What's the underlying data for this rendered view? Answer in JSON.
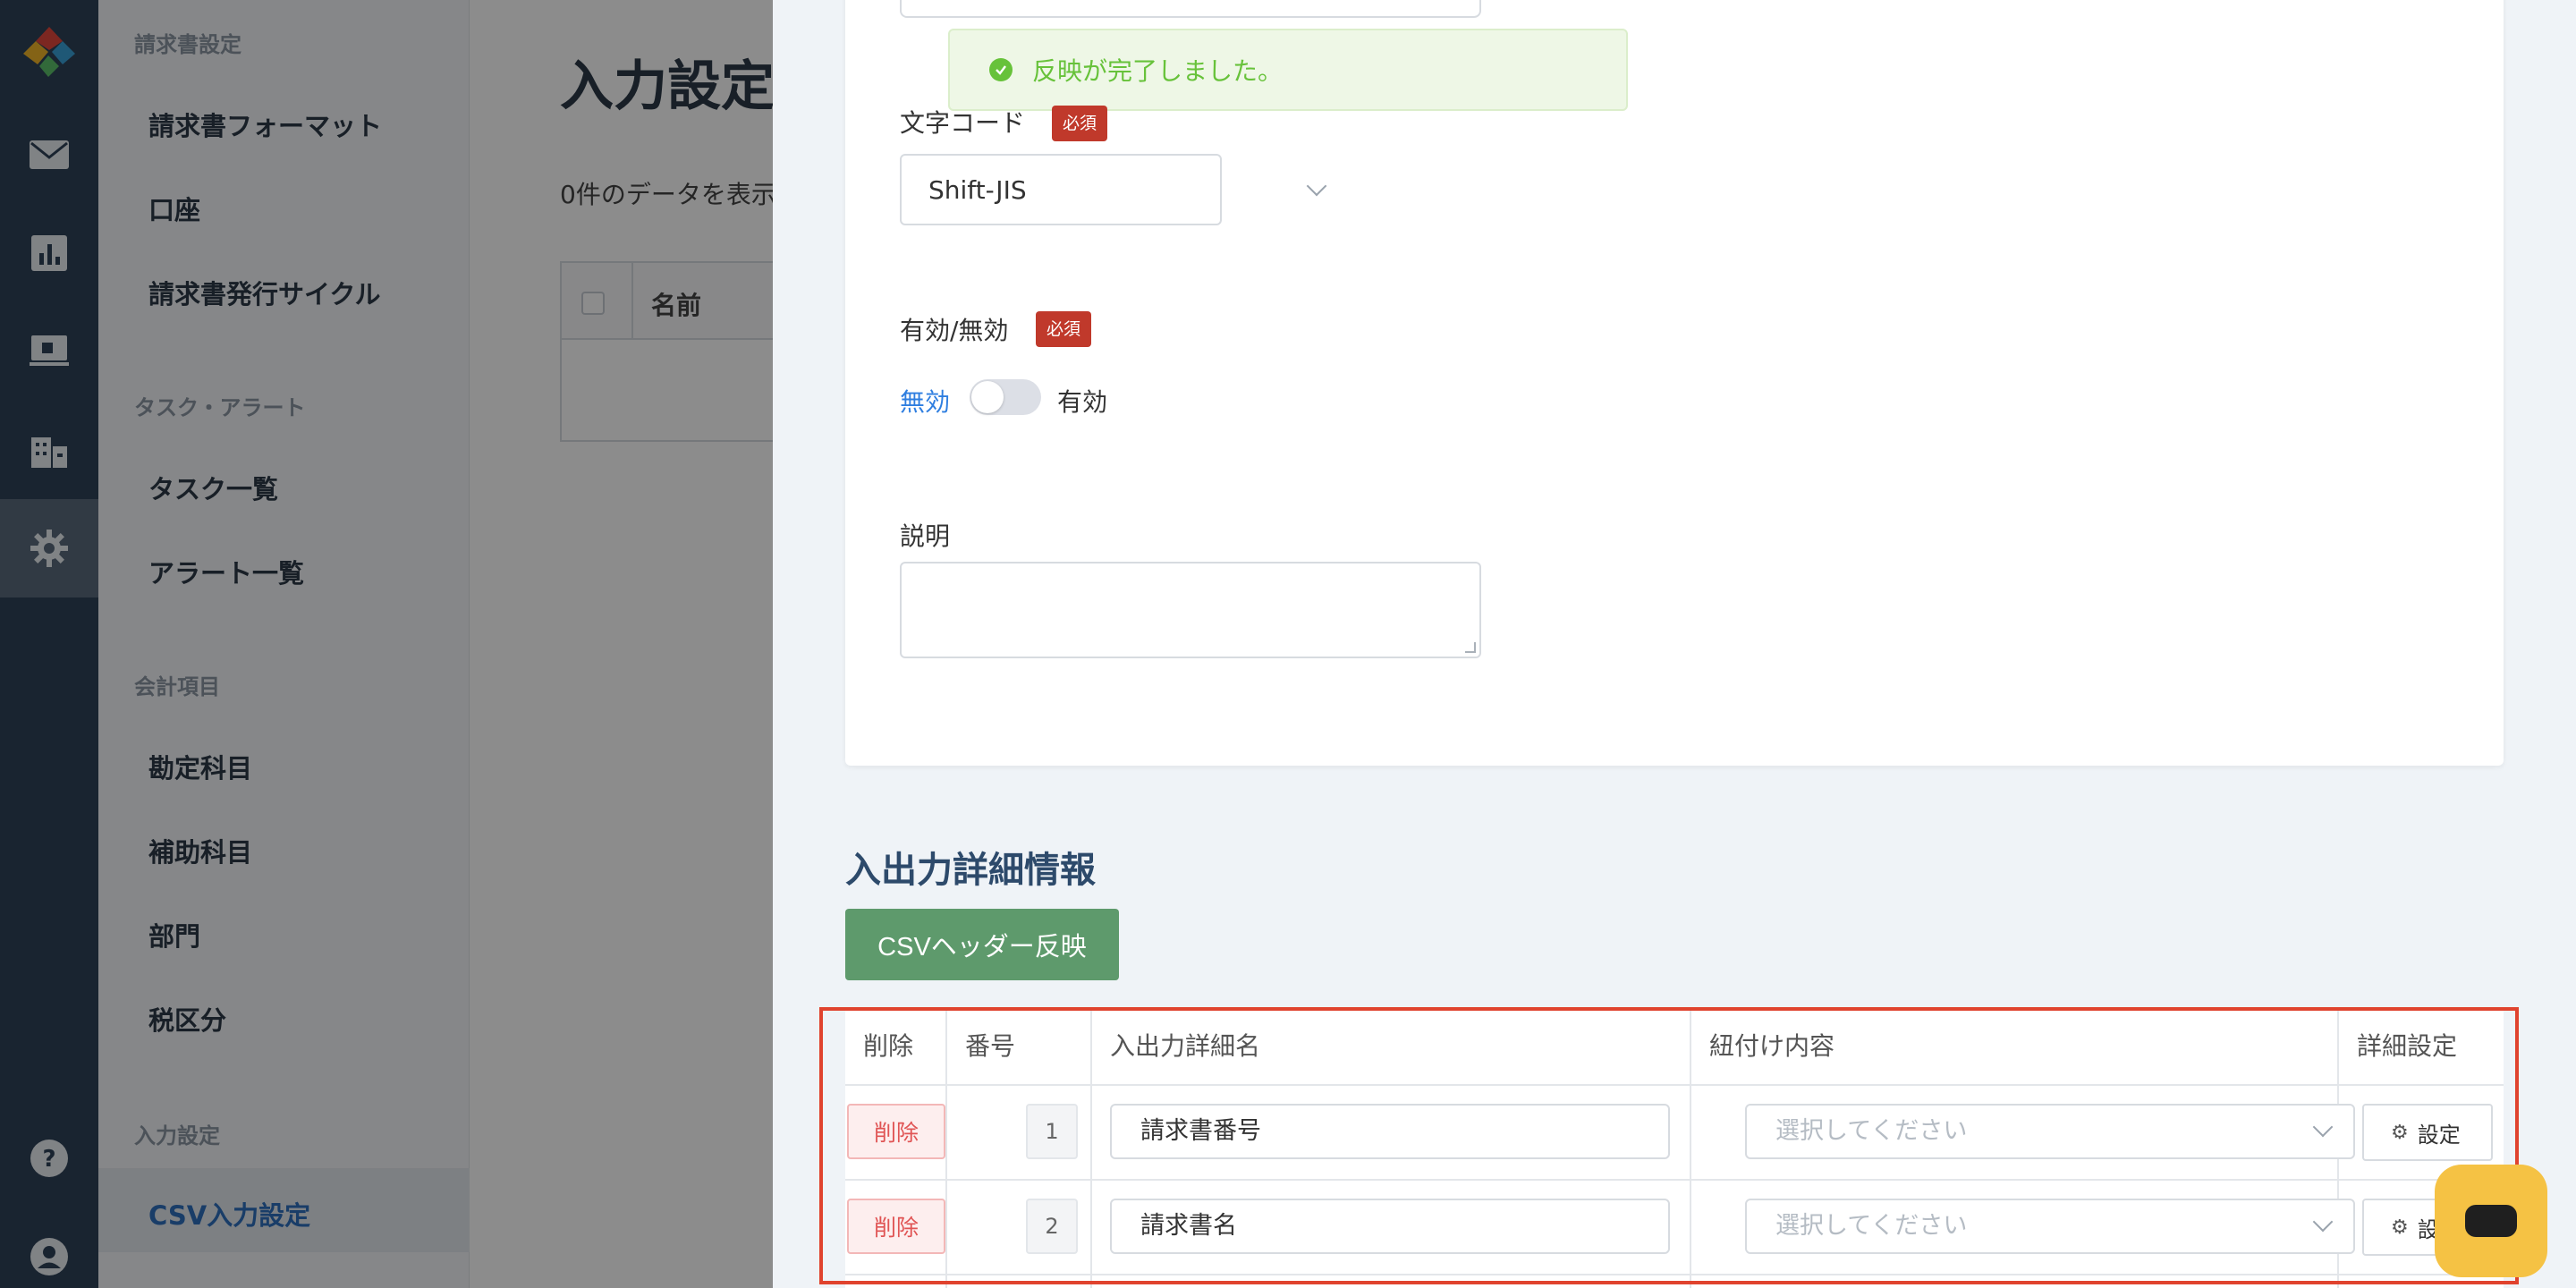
{
  "sidebar": {
    "sections": [
      {
        "title": "請求書設定",
        "items": [
          "請求書フォーマット",
          "口座",
          "請求書発行サイクル"
        ]
      },
      {
        "title": "タスク・アラート",
        "items": [
          "タスク一覧",
          "アラート一覧"
        ]
      },
      {
        "title": "会計項目",
        "items": [
          "勘定科目",
          "補助科目",
          "部門",
          "税区分"
        ]
      },
      {
        "title": "入力設定",
        "items": [
          "CSV入力設定"
        ]
      }
    ],
    "active_item": "CSV入力設定"
  },
  "rail": {
    "icons": [
      "logo-icon",
      "mail-icon",
      "chart-icon",
      "monitor-icon",
      "building-icon",
      "gear-icon",
      "help-icon",
      "user-icon"
    ],
    "active": "gear-icon"
  },
  "background_page": {
    "title": "入力設定",
    "count_text": "0件のデータを表示",
    "table_header": "名前"
  },
  "drawer": {
    "toast_message": "反映が完了しました。",
    "encoding": {
      "label": "文字コード",
      "required": "必須",
      "value": "Shift-JIS"
    },
    "enabled": {
      "label": "有効/無効",
      "required": "必須",
      "off_label": "無効",
      "on_label": "有効",
      "state": "off"
    },
    "description": {
      "label": "説明",
      "value": ""
    },
    "details": {
      "title": "入出力詳細情報",
      "csv_button": "CSVヘッダー反映",
      "columns": [
        "削除",
        "番号",
        "入出力詳細名",
        "紐付け内容",
        "詳細設定"
      ],
      "rows": [
        {
          "delete": "削除",
          "number": "1",
          "name": "請求書番号",
          "mapping_placeholder": "選択してください",
          "settings": "設定"
        },
        {
          "delete": "削除",
          "number": "2",
          "name": "請求書名",
          "mapping_placeholder": "選択してください",
          "settings": "設定"
        }
      ]
    }
  },
  "colors": {
    "rail_bg": "#2f4258",
    "accent_green": "#5e9a6c",
    "required_red": "#c0392b",
    "highlight_red": "#e0432e",
    "chat_yellow": "#f5c244"
  }
}
